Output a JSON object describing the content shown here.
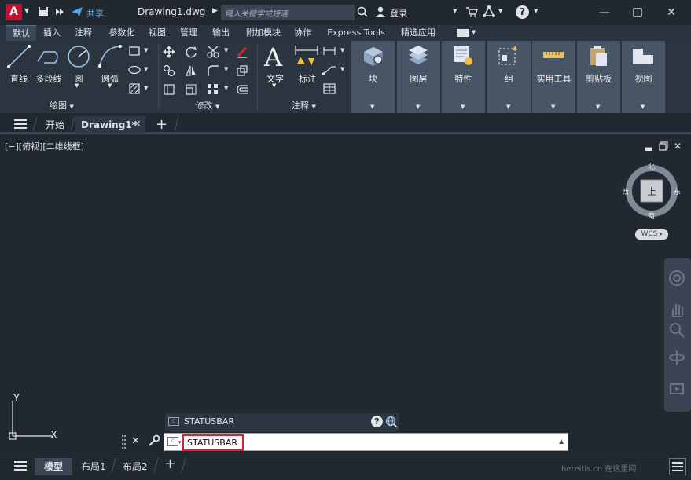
{
  "titlebar": {
    "logo": "A",
    "share_label": "共享",
    "doc_title": "Drawing1.dwg",
    "search_placeholder": "键入关键字或短语",
    "login_label": "登录"
  },
  "ribbon_tabs": [
    "默认",
    "插入",
    "注释",
    "参数化",
    "视图",
    "管理",
    "输出",
    "附加模块",
    "协作",
    "Express Tools",
    "精选应用"
  ],
  "ribbon": {
    "draw": {
      "title": "绘图",
      "line": "直线",
      "polyline": "多段线",
      "circle": "圆",
      "arc": "圆弧"
    },
    "modify": {
      "title": "修改"
    },
    "annotation": {
      "title": "注释",
      "text": "文字",
      "dimension": "标注"
    },
    "block": "块",
    "layers": "图层",
    "properties": "特性",
    "groups": "组",
    "utilities": "实用工具",
    "clipboard": "剪贴板",
    "view": "视图"
  },
  "doc_tabs": {
    "start": "开始",
    "drawing": "Drawing1*"
  },
  "canvas": {
    "view_label": "[−][俯视][二维线框]",
    "viewcube": {
      "north": "北",
      "south": "南",
      "east": "东",
      "west": "西",
      "top": "上",
      "wcs": "WCS"
    },
    "ucs": {
      "x": "X",
      "y": "Y"
    }
  },
  "command": {
    "history": "STATUSBAR",
    "input_value": "STATUSBAR"
  },
  "layout_tabs": [
    "模型",
    "布局1",
    "布局2"
  ],
  "watermark": "hereitis.cn 在这里网",
  "colors": {
    "logo_red": "#c8102e",
    "highlight_red": "#e0202a",
    "bg": "#212830"
  }
}
